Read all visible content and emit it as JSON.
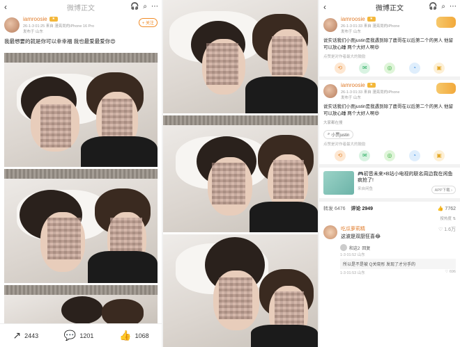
{
  "panel1": {
    "title": "微博正文",
    "user": {
      "name": "iamroosie",
      "meta": "26-1-3 01:25  来自 漫亮尚的iPhone 16 Pro",
      "location": "发布于 山东"
    },
    "follow_label": "+ 关注",
    "post_text": "我最想要的就是你可以幸幸福 我也最爱最爱你😍",
    "actions": {
      "repost": "2443",
      "comment": "1201",
      "like": "1068"
    }
  },
  "panel3": {
    "title": "微博正文",
    "post1": {
      "user": {
        "name": "iamroosie",
        "meta": "26-1-3 01:33  来自 漫亮尚的iPhone",
        "location": "发布于 山东"
      },
      "text": "说实话我们小贾justin是我遇到除了鹿哥在以后第二个的男人 他留可以放心睡 两个大好人啊😄",
      "hint": "点赞是对作者最大的鼓励"
    },
    "post2": {
      "user": {
        "name": "iamroosie",
        "meta": "26-1-3 01:33  来自 漫亮尚的iPhone",
        "location": "发布于 山东"
      },
      "text": "说实话我们小贾justin是我遇到除了鹿哥在以后第二个的男人 他留可以放心睡 两个大好人啊😄",
      "friends_label": "大家都在搜",
      "tag": "小贾justin",
      "hint": "点赞是对作者最大的鼓励"
    },
    "ad": {
      "title": "🎮初音未来×B站小电视的联名周边我在闲鱼疯抢了!",
      "source": "来自闲鱼",
      "button": "APP下载 ›"
    },
    "tabs": {
      "repost": "转发 6476",
      "comment": "评论 2949",
      "likes": "👍 7762"
    },
    "sort": "按热度 ⇅",
    "comment1": {
      "name": "吃瓜萝莉精",
      "text": "这波是双厨狂喜😂",
      "likes": "♡ 1.6万",
      "reply_name": "和这2",
      "reply_text": "回复",
      "meta": "1-3 01:52 山东"
    },
    "comment2": {
      "text": "所以是不是被 Q关晓彤 发现了才分手的",
      "mention": "Q关晓彤",
      "meta": "1-3 01:53 山东",
      "likes": "♡ 696"
    }
  }
}
